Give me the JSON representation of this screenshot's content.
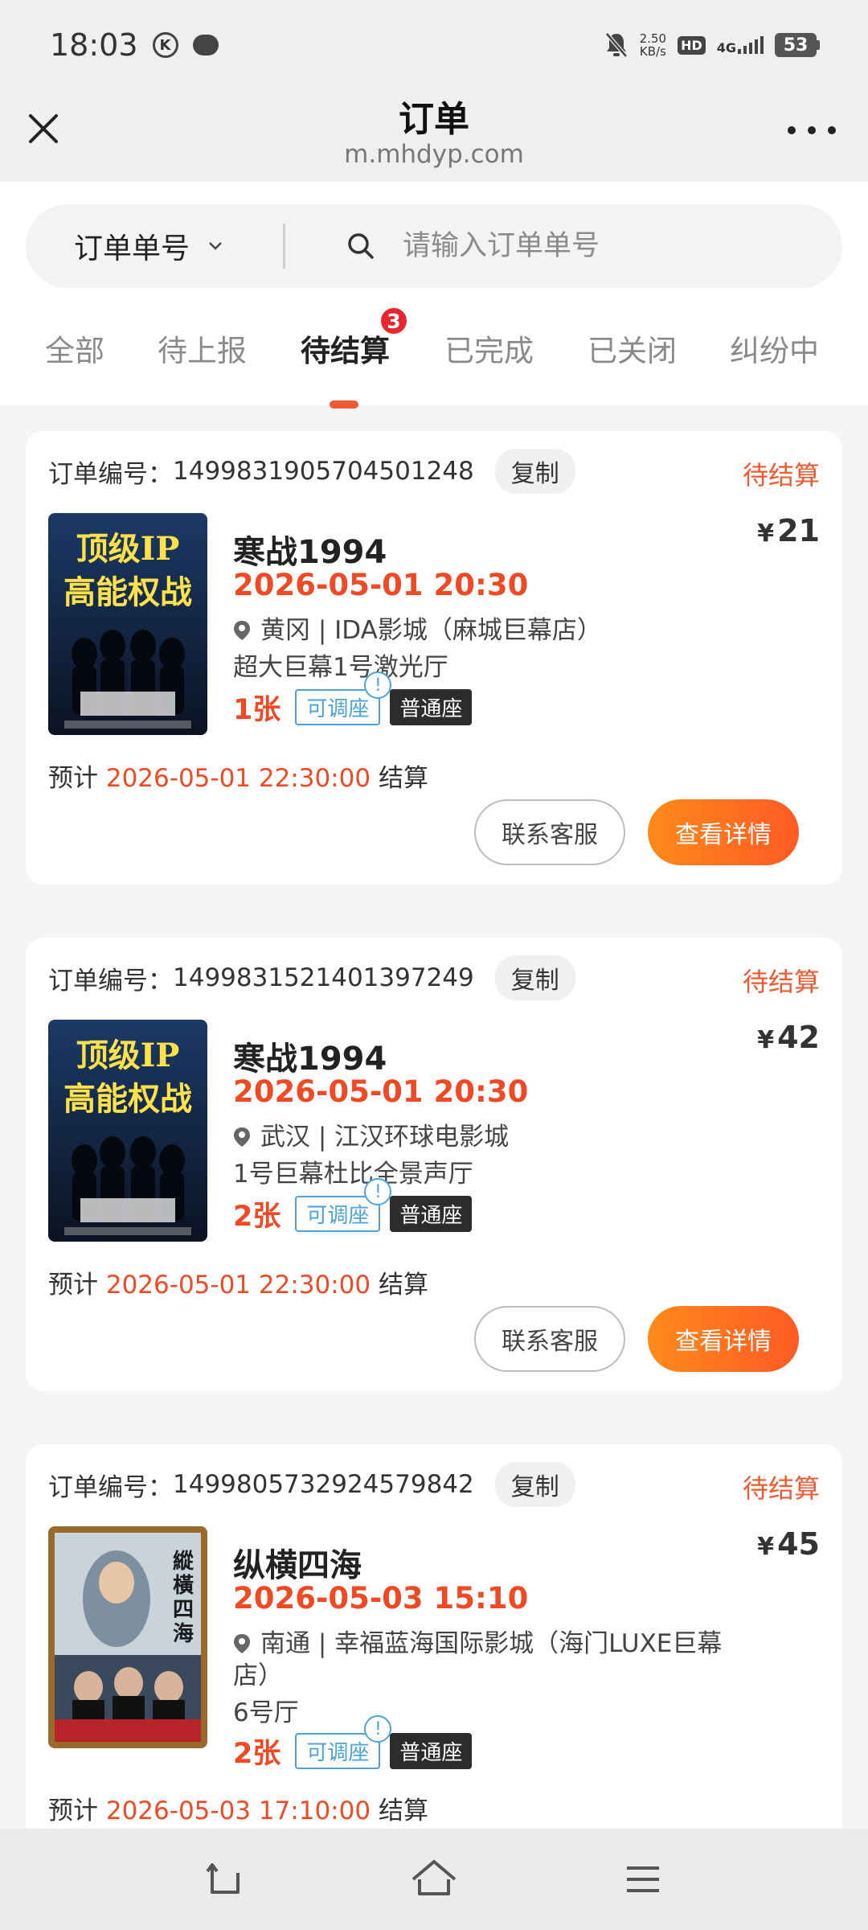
{
  "status_bar": {
    "time": "18:03",
    "net_speed_value": "2.50",
    "net_speed_unit": "KB/s",
    "hd": "HD",
    "network": "4G",
    "battery": "53"
  },
  "header": {
    "title": "订单",
    "url": "m.mhdyp.com"
  },
  "search": {
    "type_label": "订单单号",
    "placeholder": "请输入订单单号"
  },
  "tabs": [
    {
      "label": "全部"
    },
    {
      "label": "待上报"
    },
    {
      "label": "待结算",
      "badge": "3",
      "active": true
    },
    {
      "label": "已完成"
    },
    {
      "label": "已关闭"
    },
    {
      "label": "纠纷中"
    }
  ],
  "orders": [
    {
      "order_no_label": "订单编号：",
      "order_no": "1499831905704501248",
      "copy_label": "复制",
      "status": "待结算",
      "poster_text": [
        "顶级IP",
        "高能权战"
      ],
      "title": "寒战1994",
      "price_symbol": "¥",
      "price": "21",
      "showtime": "2026-05-01 20:30",
      "location": "黄冈 | IDA影城（麻城巨幕店）",
      "hall": "超大巨幕1号激光厅",
      "count": "1张",
      "adjust_tag": "可调座",
      "info_mark": "!",
      "seat_tag": "普通座",
      "settle_prefix": "预计",
      "settle_time": "2026-05-01 22:30:00",
      "settle_suffix": "结算",
      "contact_label": "联系客服",
      "detail_label": "查看详情"
    },
    {
      "order_no_label": "订单编号：",
      "order_no": "1499831521401397249",
      "copy_label": "复制",
      "status": "待结算",
      "poster_text": [
        "顶级IP",
        "高能权战"
      ],
      "title": "寒战1994",
      "price_symbol": "¥",
      "price": "42",
      "showtime": "2026-05-01 20:30",
      "location": "武汉 | 江汉环球电影城",
      "hall": "1号巨幕杜比全景声厅",
      "count": "2张",
      "adjust_tag": "可调座",
      "info_mark": "!",
      "seat_tag": "普通座",
      "settle_prefix": "预计",
      "settle_time": "2026-05-01 22:30:00",
      "settle_suffix": "结算",
      "contact_label": "联系客服",
      "detail_label": "查看详情"
    },
    {
      "order_no_label": "订单编号：",
      "order_no": "1499805732924579842",
      "copy_label": "复制",
      "status": "待结算",
      "poster_text": [
        "縱",
        "橫",
        "四",
        "海"
      ],
      "title": "纵横四海",
      "price_symbol": "¥",
      "price": "45",
      "showtime": "2026-05-03 15:10",
      "location": "南通 | 幸福蓝海国际影城（海门LUXE巨幕店）",
      "hall": "6号厅",
      "count": "2张",
      "adjust_tag": "可调座",
      "info_mark": "!",
      "seat_tag": "普通座",
      "settle_prefix": "预计",
      "settle_time": "2026-05-03 17:10:00",
      "settle_suffix": "结算"
    }
  ],
  "bottom_nav": {
    "icons": [
      "back-icon",
      "home-icon",
      "menu-icon"
    ]
  },
  "colors": {
    "accent": "#ef4a25",
    "status": "#ef5a30",
    "badge": "#e8262f",
    "tag_blue": "#4ca3d9"
  }
}
